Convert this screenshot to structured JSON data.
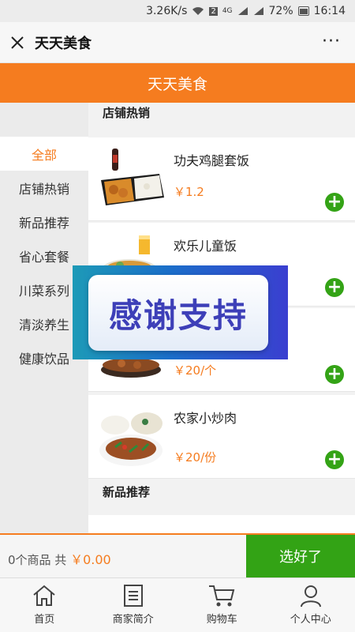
{
  "status_bar": {
    "speed": "3.26K/s",
    "battery": "72%",
    "time": "16:14",
    "net_label": "4G",
    "sim_badge": "2"
  },
  "title_bar": {
    "title": "天天美食",
    "more_label": "···"
  },
  "header": {
    "title": "天天美食"
  },
  "sidebar": {
    "items": [
      {
        "label": "全部",
        "active": true
      },
      {
        "label": "店铺热销"
      },
      {
        "label": "新品推荐"
      },
      {
        "label": "省心套餐"
      },
      {
        "label": "川菜系列"
      },
      {
        "label": "清淡养生"
      },
      {
        "label": "健康饮品"
      }
    ]
  },
  "sections": [
    {
      "title": "店铺热销",
      "products": [
        {
          "name": "功夫鸡腿套饭",
          "price": "￥1.2",
          "image_icon": "chicken-rice-bento"
        },
        {
          "name": "欢乐儿童饭",
          "price": "",
          "image_icon": "kids-meal-with-juice"
        },
        {
          "name": "",
          "price": "￥20/个",
          "image_icon": "clay-pot-dish"
        },
        {
          "name": "农家小炒肉",
          "price": "￥20/份",
          "image_icon": "stir-fried-pork"
        }
      ]
    },
    {
      "title": "新品推荐",
      "products": []
    }
  ],
  "overlay": {
    "text": "感谢支持"
  },
  "cart": {
    "summary": "0个商品 共",
    "total": "￥0.00",
    "checkout_label": "选好了"
  },
  "tabs": [
    {
      "label": "首页",
      "icon": "home-icon"
    },
    {
      "label": "商家简介",
      "icon": "document-icon"
    },
    {
      "label": "购物车",
      "icon": "cart-icon"
    },
    {
      "label": "个人中心",
      "icon": "user-icon"
    }
  ],
  "colors": {
    "accent": "#f57c1f",
    "add_button": "#34a316",
    "checkout": "#33a315"
  }
}
